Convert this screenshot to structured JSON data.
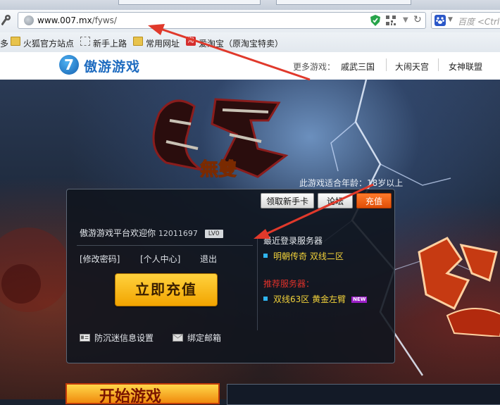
{
  "browser": {
    "url_domain": "www.007.mx",
    "url_path": "/fyws/",
    "search_placeholder": "百度 <Ctrl+",
    "bookmarks": [
      {
        "label": "多"
      },
      {
        "label": "火狐官方站点"
      },
      {
        "label": "新手上路"
      },
      {
        "label": "常用网址"
      },
      {
        "label": "爱淘宝（原淘宝特卖）"
      }
    ],
    "taobao_icon": "淘"
  },
  "site": {
    "logo_badge": "7",
    "logo_text": "傲游游戏",
    "more_games_label": "更多游戏：",
    "more_games": [
      "戚武三国",
      "大闹天宫",
      "女神联盟"
    ]
  },
  "hero": {
    "age_notice": "此游戏适合年龄：18岁以上",
    "game_logo_text": "無雙"
  },
  "panel": {
    "btn_newbie_card": "领取新手卡",
    "btn_forum": "论坛",
    "btn_recharge": "充值",
    "welcome": "傲游游戏平台欢迎你",
    "user_id": "12011697",
    "level_badge": "LV0",
    "link_change_pwd": "[修改密码]",
    "link_user_center": "[个人中心]",
    "link_logout": "退出",
    "big_recharge": "立即充值",
    "anti_addiction": "防沉迷信息设置",
    "bind_email": "绑定邮箱",
    "recent_title": "最近登录服务器",
    "recent_server": "明朝传奇  双线二区",
    "recommend_title": "推荐服务器：",
    "recommend_server": "双线63区  黄金左臂",
    "new_badge": "NEW"
  },
  "bottom": {
    "start_game": "开始游戏"
  },
  "colors": {
    "accent_orange": "#e04f08",
    "recharge_gold": "#f2a400",
    "server_yellow": "#f2d23a",
    "recommend_red": "#e0322a",
    "annotation_arrow": "#e0392b"
  }
}
